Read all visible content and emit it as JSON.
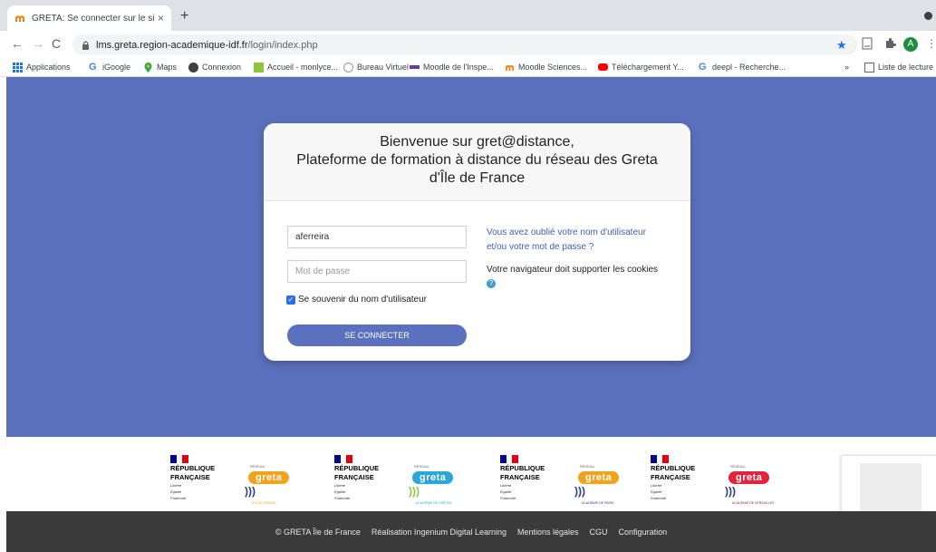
{
  "browser": {
    "tab_title": "GRETA: Se connecter sur le site",
    "tab_close": "×",
    "new_tab": "+",
    "url_domain": "lms.greta.region-academique-idf.fr",
    "url_path": "/login/index.php",
    "avatar_letter": "A",
    "bookmarks": [
      {
        "label": "Applications",
        "icon": "apps-grid-icon"
      },
      {
        "label": "iGoogle",
        "icon": "google-icon"
      },
      {
        "label": "Maps",
        "icon": "maps-pin-icon"
      },
      {
        "label": "Connexion",
        "icon": "connexion-icon"
      },
      {
        "label": "Accueil - monlyce...",
        "icon": "monlycee-icon"
      },
      {
        "label": "Bureau Virtuel",
        "icon": "bureau-virtuel-icon"
      },
      {
        "label": "Moodle de l'Inspe...",
        "icon": "moodle-inspe-icon"
      },
      {
        "label": "Moodle Sciences...",
        "icon": "moodle-greta-icon"
      },
      {
        "label": "Téléchargement Y...",
        "icon": "youtube-icon"
      },
      {
        "label": "deepl - Recherche...",
        "icon": "google-icon"
      }
    ],
    "bookmarks_overflow": "»",
    "reading_list": "Liste de lecture"
  },
  "login": {
    "welcome_line1": "Bienvenue sur gret@distance,",
    "welcome_line2": "Plateforme de formation à distance du réseau des Greta",
    "welcome_line3": "d'Île de France",
    "username_value": "aferreira",
    "password_placeholder": "Mot de passe",
    "remember_label": "Se souvenir du nom d'utilisateur",
    "remember_checked": true,
    "login_button": "SE CONNECTER",
    "forgot_line1": "Vous avez oublié votre nom d'utilisateur",
    "forgot_line2": "et/ou votre mot de passe ?",
    "cookies_text": "Votre navigateur doit supporter les cookies"
  },
  "logos": [
    {
      "rf_line1": "RÉPUBLIQUE",
      "rf_line2": "FRANÇAISE",
      "motto1": "Liberté",
      "motto2": "Égalité",
      "motto3": "Fraternité",
      "reseau": "RÉSEAU",
      "greta": "greta",
      "greta_color": "#f3a21b",
      "sub": "ÎLE-DE-FRANCE"
    },
    {
      "rf_line1": "RÉPUBLIQUE",
      "rf_line2": "FRANÇAISE",
      "motto1": "Liberté",
      "motto2": "Égalité",
      "motto3": "Fraternité",
      "reseau": "RÉSEAU",
      "greta": "greta",
      "greta_color": "#2aa6d8",
      "sub": "ACADÉMIE DE CRÉTEIL"
    },
    {
      "rf_line1": "RÉPUBLIQUE",
      "rf_line2": "FRANÇAISE",
      "motto1": "Liberté",
      "motto2": "Égalité",
      "motto3": "Fraternité",
      "reseau": "RÉSEAU",
      "greta": "greta",
      "greta_color": "#f3a21b",
      "sub": "ACADÉMIE DE PARIS"
    },
    {
      "rf_line1": "RÉPUBLIQUE",
      "rf_line2": "FRANÇAISE",
      "motto1": "Liberté",
      "motto2": "Égalité",
      "motto3": "Fraternité",
      "reseau": "RÉSEAU",
      "greta": "greta",
      "greta_color": "#e2233a",
      "sub": "ACADÉMIE DE VERSAILLES"
    }
  ],
  "footer": {
    "copyright": "© GRETA Île de France",
    "realisation": "Réalisation Ingenium Digital Learning",
    "mentions": "Mentions légales",
    "cgu": "CGU",
    "configuration": "Configuration"
  },
  "colors": {
    "page_background": "#5b71bd",
    "link": "#3e62b0",
    "footer": "#3a3a3a"
  }
}
